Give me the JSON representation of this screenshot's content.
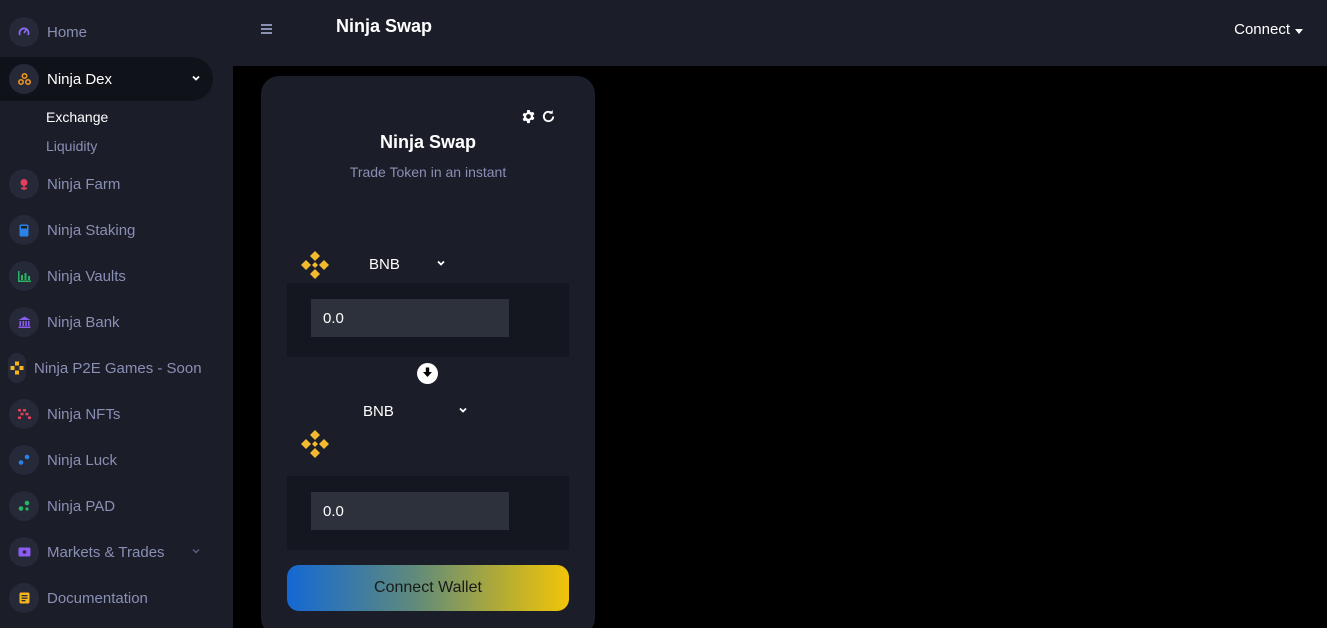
{
  "header": {
    "title": "Ninja Swap",
    "connect_label": "Connect"
  },
  "sidebar": {
    "items": [
      {
        "label": "Home",
        "icon": "gauge-icon",
        "color": "#8a6cf0"
      },
      {
        "label": "Ninja Dex",
        "icon": "dex-nodes-icon",
        "color": "#f79a1e",
        "active": true,
        "expanded": true
      },
      {
        "label": "Ninja Farm",
        "icon": "rose-icon",
        "color": "#e0405a"
      },
      {
        "label": "Ninja Staking",
        "icon": "calculator-icon",
        "color": "#2b82e6"
      },
      {
        "label": "Ninja Vaults",
        "icon": "bar-chart-icon",
        "color": "#29b463"
      },
      {
        "label": "Ninja Bank",
        "icon": "bank-icon",
        "color": "#8a5cf0"
      },
      {
        "label": "Ninja P2E Games - Soon",
        "icon": "gamepad-icon",
        "color": "#f7b51e"
      },
      {
        "label": "Ninja NFTs",
        "icon": "nft-grid-icon",
        "color": "#e0405a"
      },
      {
        "label": "Ninja Luck",
        "icon": "luck-dots-icon",
        "color": "#2b82e6"
      },
      {
        "label": "Ninja PAD",
        "icon": "pad-dots-icon",
        "color": "#29b463"
      },
      {
        "label": "Markets & Trades",
        "icon": "ticket-icon",
        "color": "#8a5cf0"
      },
      {
        "label": "Documentation",
        "icon": "document-icon",
        "color": "#f7b51e"
      }
    ],
    "sub_items": [
      {
        "label": "Exchange",
        "active": true
      },
      {
        "label": "Liquidity"
      }
    ]
  },
  "swap": {
    "title": "Ninja Swap",
    "subtitle": "Trade Token in an instant",
    "from": {
      "symbol": "BNB",
      "amount": "0.0"
    },
    "to": {
      "symbol": "BNB",
      "amount": "0.0"
    },
    "connect_wallet_label": "Connect Wallet"
  },
  "colors": {
    "bnb_yellow": "#f3ba2f",
    "panel": "#1b1d29",
    "muted_text": "#8a8fb4"
  }
}
